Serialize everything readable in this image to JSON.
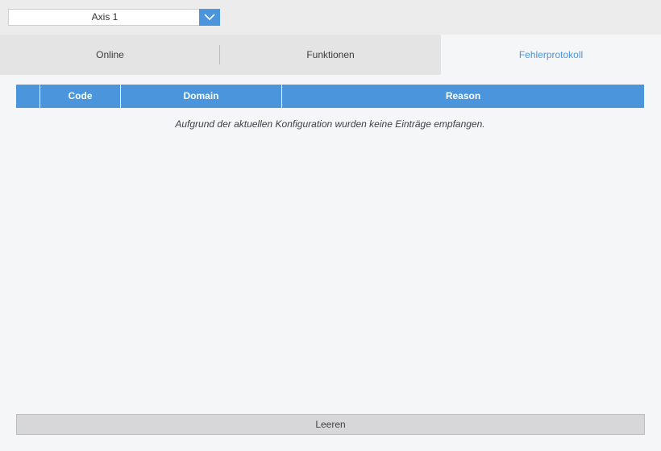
{
  "axis_selector": {
    "value": "Axis 1",
    "dropdown_icon": "chevron-down-icon"
  },
  "tabs": [
    {
      "label": "Online",
      "active": false
    },
    {
      "label": "Funktionen",
      "active": false
    },
    {
      "label": "Fehlerprotokoll",
      "active": true
    }
  ],
  "table": {
    "columns": [
      "",
      "Code",
      "Domain",
      "Reason"
    ],
    "rows": [],
    "empty_message": "Aufgrund der aktuellen Konfiguration wurden keine Einträge empfangen."
  },
  "actions": {
    "clear_label": "Leeren"
  },
  "colors": {
    "accent": "#4a95db",
    "background": "#f4f6f8",
    "tab_bar": "#e4e4e4",
    "button": "#d7d7d9"
  }
}
